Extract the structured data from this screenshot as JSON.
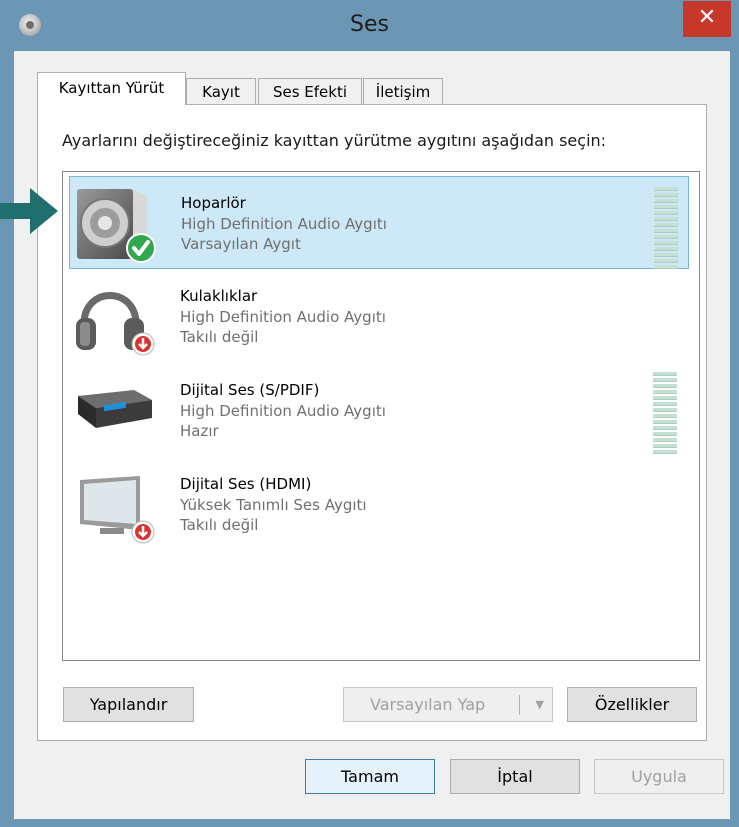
{
  "window": {
    "title": "Ses",
    "close_glyph": "✕",
    "icon": "speaker-app-icon"
  },
  "tabs": [
    {
      "label": "Kayıttan Yürüt",
      "active": true
    },
    {
      "label": "Kayıt",
      "active": false
    },
    {
      "label": "Ses Efekti",
      "active": false
    },
    {
      "label": "İletişim",
      "active": false
    }
  ],
  "instruction": "Ayarlarını değiştireceğiniz kayıttan yürütme aygıtını aşağıdan seçin:",
  "devices": [
    {
      "name": "Hoparlör",
      "description": "High Definition Audio Aygıtı",
      "status": "Varsayılan Aygıt",
      "icon": "speaker-icon",
      "badge": "default-check-icon",
      "selected": true
    },
    {
      "name": "Kulaklıklar",
      "description": "High Definition Audio Aygıtı",
      "status": "Takılı değil",
      "icon": "headphones-icon",
      "badge": "unplugged-icon",
      "selected": false
    },
    {
      "name": "Dijital Ses (S/PDIF)",
      "description": "High Definition Audio Aygıtı",
      "status": "Hazır",
      "icon": "receiver-icon",
      "badge": "",
      "selected": false
    },
    {
      "name": "Dijital Ses (HDMI)",
      "description": "Yüksek Tanımlı Ses Aygıtı",
      "status": "Takılı değil",
      "icon": "monitor-icon",
      "badge": "unplugged-icon",
      "selected": false
    }
  ],
  "buttons": {
    "configure": "Yapılandır",
    "set_default": "Varsayılan Yap",
    "properties": "Özellikler",
    "ok": "Tamam",
    "cancel": "İptal",
    "apply": "Uygula"
  },
  "colors": {
    "frame": "#6b97b4",
    "close": "#c7382a",
    "selection": "#cde8f7",
    "arrow": "#1f6f6f"
  }
}
